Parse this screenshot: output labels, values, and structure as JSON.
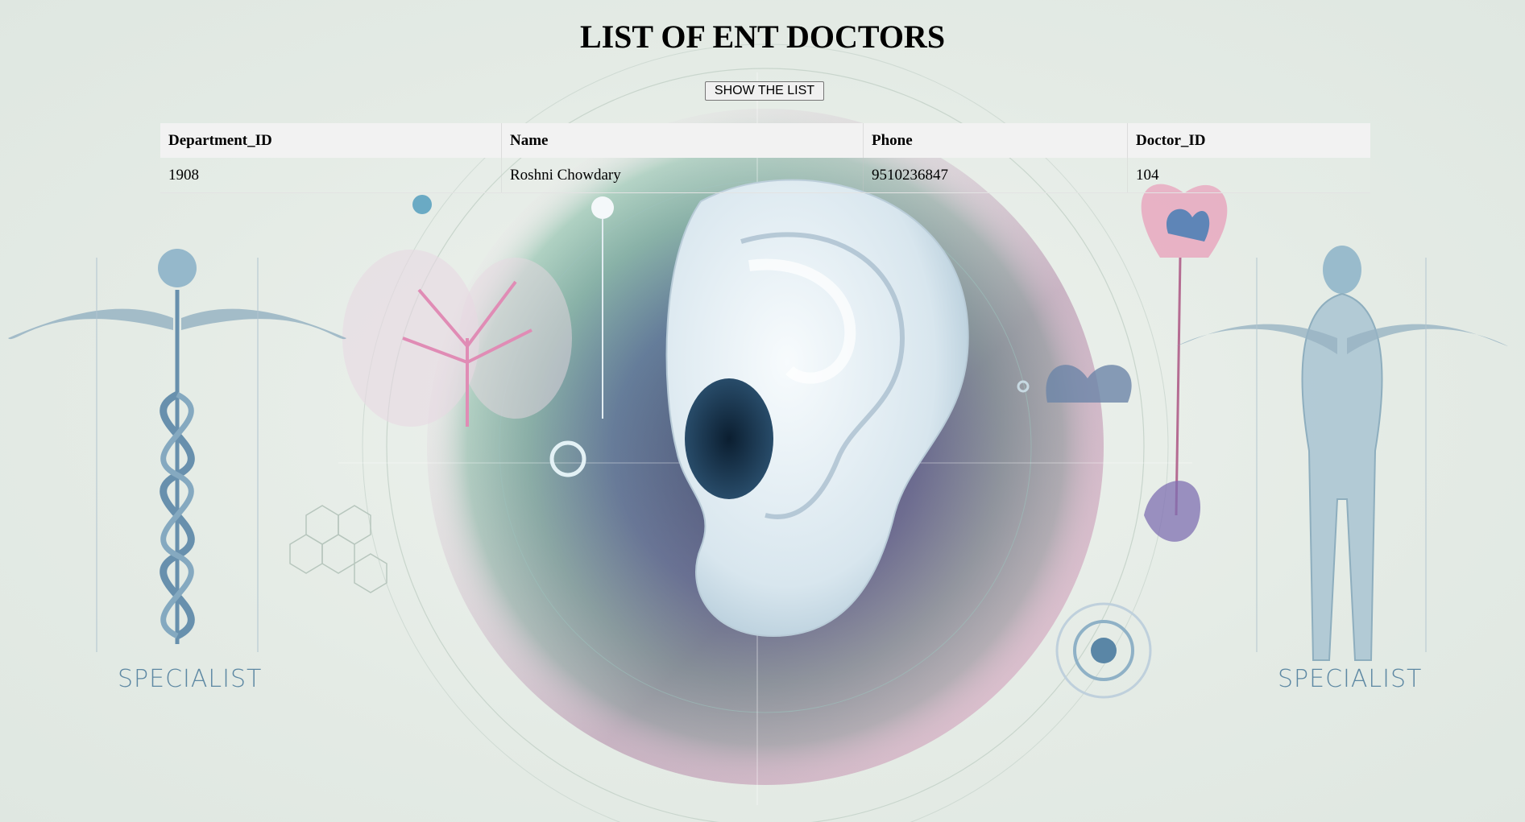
{
  "page": {
    "title": "LIST OF ENT DOCTORS",
    "show_button_label": "SHOW THE LIST"
  },
  "table": {
    "columns": [
      "Department_ID",
      "Name",
      "Phone",
      "Doctor_ID"
    ],
    "rows": [
      [
        "1908",
        "Roshni Chowdary",
        "9510236847",
        "104"
      ]
    ]
  },
  "background": {
    "left_caption": "SPECIALIST",
    "right_caption": "SPECIALIST",
    "colors": {
      "accent_teal": "#5d88a3",
      "accent_green": "#7fb7a0",
      "accent_pink": "#d98fae",
      "page_bg": "#e4ebe5"
    }
  }
}
